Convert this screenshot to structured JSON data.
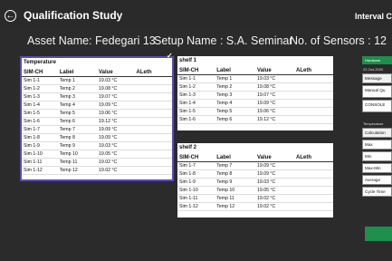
{
  "header": {
    "title": "Qualification Study",
    "right_text": "Interval Ca"
  },
  "info": {
    "asset": "Asset Name: Fedegari 13",
    "setup": "Setup Name : S.A. Seminar",
    "sensors": "No. of Sensors : 12"
  },
  "temperature_panel": {
    "title": "Temperature",
    "columns": [
      "SIM-CH",
      "Label",
      "Value",
      "ALeth"
    ],
    "rows": [
      [
        "Sim 1-1",
        "Temp 1",
        "19.03 °C",
        ""
      ],
      [
        "Sim 1-2",
        "Temp 2",
        "19.08 °C",
        ""
      ],
      [
        "Sim 1-3",
        "Temp 3",
        "19.07 °C",
        ""
      ],
      [
        "Sim 1-4",
        "Temp 4",
        "19.09 °C",
        ""
      ],
      [
        "Sim 1-5",
        "Temp 5",
        "19.06 °C",
        ""
      ],
      [
        "Sim 1-6",
        "Temp 6",
        "19.12 °C",
        ""
      ],
      [
        "Sim 1-7",
        "Temp 7",
        "19.09 °C",
        ""
      ],
      [
        "Sim 1-8",
        "Temp 8",
        "19.09 °C",
        ""
      ],
      [
        "Sim 1-9",
        "Temp 9",
        "19.03 °C",
        ""
      ],
      [
        "Sim 1-10",
        "Temp 10",
        "19.05 °C",
        ""
      ],
      [
        "Sim 1-11",
        "Temp 11",
        "19.02 °C",
        ""
      ],
      [
        "Sim 1-12",
        "Temp 12",
        "19.02 °C",
        ""
      ]
    ]
  },
  "shelf1": {
    "title": "shelf 1",
    "columns": [
      "SIM-CH",
      "Label",
      "Value",
      "ALeth"
    ],
    "rows": [
      [
        "Sim 1-1",
        "Temp 1",
        "19.03 °C",
        ""
      ],
      [
        "Sim 1-2",
        "Temp 2",
        "19.08 °C",
        ""
      ],
      [
        "Sim 1-3",
        "Temp 3",
        "19.07 °C",
        ""
      ],
      [
        "Sim 1-4",
        "Temp 4",
        "19.09 °C",
        ""
      ],
      [
        "Sim 1-5",
        "Temp 5",
        "19.06 °C",
        ""
      ],
      [
        "Sim 1-6",
        "Temp 6",
        "19.12 °C",
        ""
      ]
    ]
  },
  "shelf2": {
    "title": "shelf 2",
    "columns": [
      "SIM-CH",
      "Label",
      "Value",
      "ALeth"
    ],
    "rows": [
      [
        "Sim 1-7",
        "Temp 7",
        "19.09 °C",
        ""
      ],
      [
        "Sim 1-8",
        "Temp 8",
        "19.09 °C",
        ""
      ],
      [
        "Sim 1-9",
        "Temp 9",
        "19.03 °C",
        ""
      ],
      [
        "Sim 1-10",
        "Temp 10",
        "19.05 °C",
        ""
      ],
      [
        "Sim 1-11",
        "Temp 11",
        "19.02 °C",
        ""
      ],
      [
        "Sim 1-12",
        "Temp 12",
        "19.02 °C",
        ""
      ]
    ]
  },
  "side_panel": {
    "hardware_button": "Hardware",
    "date": "22-Oct-2020",
    "message_header": "Message",
    "messages": [
      "Manual Qu",
      "CONSOLE"
    ],
    "temperature_label": "Temperature",
    "calc_header": "Calculation",
    "calc_items": [
      "Max",
      "Min",
      "Max-Min",
      "Average",
      "Cycle Time"
    ]
  },
  "colors": {
    "background": "#2b2b2b",
    "selection_border": "#5b4bb7",
    "green": "#1e8f4c"
  }
}
